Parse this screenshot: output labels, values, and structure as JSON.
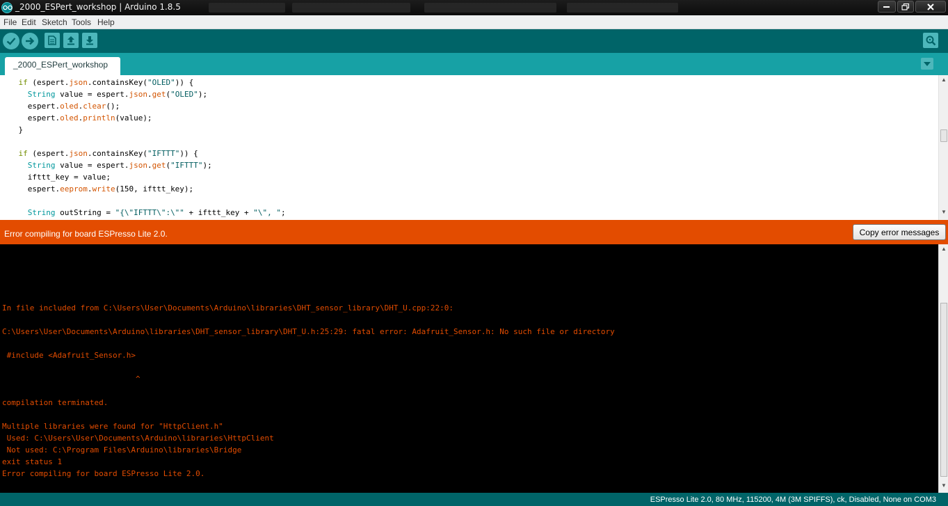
{
  "window": {
    "title": "_2000_ESPert_workshop | Arduino 1.8.5"
  },
  "menu": {
    "items": [
      "File",
      "Edit",
      "Sketch",
      "Tools",
      "Help"
    ]
  },
  "toolbar": {
    "buttons": [
      "verify-icon",
      "upload-icon",
      "new-icon",
      "open-icon",
      "save-icon",
      "serial-monitor-icon"
    ]
  },
  "tabs": {
    "active": "_2000_ESPert_workshop"
  },
  "editor": {
    "lines": [
      "if (espert.json.containsKey(\"OLED\")) {",
      "  String value = espert.json.get(\"OLED\");",
      "  espert.oled.clear();",
      "  espert.oled.println(value);",
      "}",
      "",
      "if (espert.json.containsKey(\"IFTTT\")) {",
      "  String value = espert.json.get(\"IFTTT\");",
      "  ifttt_key = value;",
      "  espert.eeprom.write(150, ifttt_key);",
      "",
      "  String outString = \"{\\\"IFTTT\\\":\\\"\" + ifttt_key + \"\\\", \";"
    ]
  },
  "error_banner": {
    "message": "Error compiling for board ESPresso Lite 2.0.",
    "copy_label": "Copy error messages"
  },
  "console": {
    "lines": [
      "In file included from C:\\Users\\User\\Documents\\Arduino\\libraries\\DHT_sensor_library\\DHT_U.cpp:22:0:",
      "C:\\Users\\User\\Documents\\Arduino\\libraries\\DHT_sensor_library\\DHT_U.h:25:29: fatal error: Adafruit_Sensor.h: No such file or directory",
      " #include <Adafruit_Sensor.h>",
      "                             ^",
      "compilation terminated.",
      "Multiple libraries were found for \"HttpClient.h\"",
      " Used: C:\\Users\\User\\Documents\\Arduino\\libraries\\HttpClient",
      " Not used: C:\\Program Files\\Arduino\\libraries\\Bridge",
      "exit status 1",
      "Error compiling for board ESPresso Lite 2.0."
    ]
  },
  "statusbar": {
    "board_info": "ESPresso Lite 2.0, 80 MHz, 115200, 4M (3M SPIFFS), ck, Disabled, None on COM3"
  },
  "colors": {
    "toolbar": "#006468",
    "tabstrip": "#17a1a5",
    "error": "#e34c00",
    "console_bg": "#000000"
  }
}
